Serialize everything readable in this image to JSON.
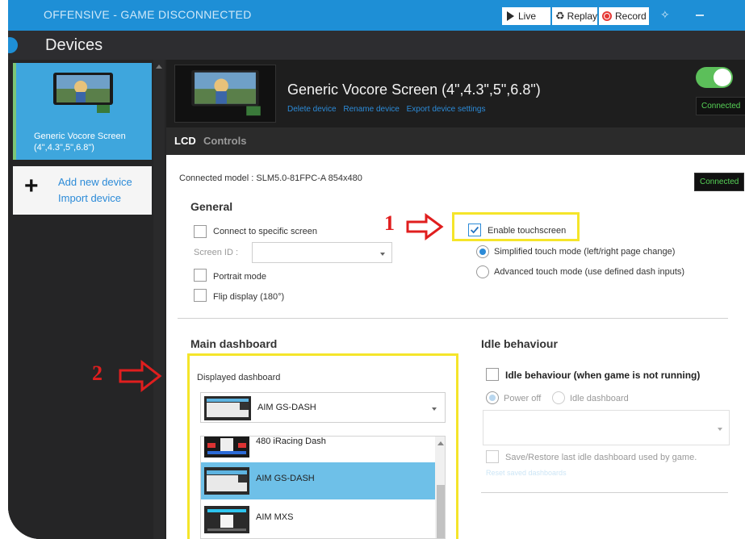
{
  "window": {
    "title": "COUNTER-STRIKE: GLOBAL OFFENSIVE - GAME DISCONNECTED",
    "title_visible": "OFFENSIVE - GAME DISCONNECTED",
    "live_label": "Live",
    "replay_label": "Replay",
    "record_label": "Record"
  },
  "header": {
    "title": "Devices"
  },
  "sidebar": {
    "device_name": "Generic Vocore Screen (4\",4.3\",5\",6.8\")",
    "add_new_device": "Add new device",
    "import_device": "Import device"
  },
  "device": {
    "title": "Generic Vocore Screen (4\",4.3\",5\",6.8\")",
    "links": [
      "Delete device",
      "Rename device",
      "Export device settings"
    ],
    "status": "Connected"
  },
  "tabs": [
    "LCD",
    "Controls"
  ],
  "lcd": {
    "connected_model": "Connected model : SLM5.0-81FPC-A 854x480",
    "status": "Connected",
    "general": {
      "heading": "General",
      "connect_specific": "Connect to specific screen",
      "screen_id_label": "Screen ID :",
      "portrait_mode": "Portrait mode",
      "flip_display": "Flip display (180°)"
    },
    "touch": {
      "enable_touchscreen": "Enable touchscreen",
      "enable_checked": true,
      "simplified": "Simplified touch mode (left/right page change)",
      "advanced": "Advanced touch mode (use defined dash inputs)"
    },
    "main_dashboard": {
      "heading": "Main dashboard",
      "displayed_label": "Displayed dashboard",
      "selected": "AIM GS-DASH",
      "options": [
        "480 iRacing Dash",
        "AIM GS-DASH",
        "AIM MXS"
      ]
    },
    "idle": {
      "heading": "Idle behaviour",
      "checkbox_label": "Idle behaviour (when game is not running)",
      "power_off": "Power off",
      "idle_dashboard": "Idle dashboard",
      "save_restore": "Save/Restore last idle dashboard used by game.",
      "reset_link": "Reset saved dashboards"
    }
  },
  "annotations": {
    "marker1": "1",
    "marker2": "2"
  },
  "colors": {
    "accent": "#1e8fd6",
    "highlight": "#f5e52a",
    "annotation_red": "#e01e1e",
    "connected_green": "#57d357"
  }
}
